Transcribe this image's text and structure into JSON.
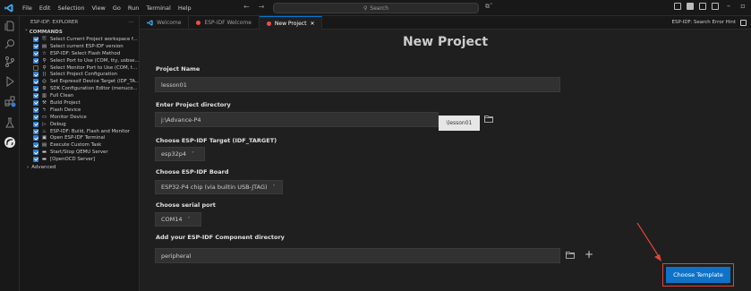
{
  "menu": [
    "File",
    "Edit",
    "Selection",
    "View",
    "Go",
    "Run",
    "Terminal",
    "Help"
  ],
  "search": {
    "placeholder": "Search"
  },
  "sidebar": {
    "title": "ESP-IDF: EXPLORER",
    "more": "···",
    "section": "COMMANDS",
    "items": [
      {
        "label": "Select Current Project workspace f...",
        "icon": "folders-icon",
        "glyph": "⎘",
        "checked": true
      },
      {
        "label": "Select current ESP-IDF version",
        "icon": "stack-icon",
        "glyph": "▤",
        "checked": true
      },
      {
        "label": "ESP-IDF: Select Flash Method",
        "icon": "star-icon",
        "glyph": "☆",
        "checked": true
      },
      {
        "label": "Select Port to Use (COM, tty, usbse...",
        "icon": "plug-icon",
        "glyph": "⚲",
        "checked": true
      },
      {
        "label": "Select Monitor Port to Use (COM, t...",
        "icon": "plug-icon",
        "glyph": "⚲",
        "checked": false
      },
      {
        "label": "Select Project Configuration",
        "icon": "brackets-icon",
        "glyph": "⟨⟩",
        "checked": true
      },
      {
        "label": "Set Espressif Device Target (IDF_TA...",
        "icon": "chip-icon",
        "glyph": "◎",
        "checked": true
      },
      {
        "label": "SDK Configuration Editor (menuco...",
        "icon": "gear-icon",
        "glyph": "⚙",
        "checked": true
      },
      {
        "label": "Full Clean",
        "icon": "trash-icon",
        "glyph": "▥",
        "checked": true
      },
      {
        "label": "Build Project",
        "icon": "wrench-icon",
        "glyph": "⚒",
        "checked": true
      },
      {
        "label": "Flash Device",
        "icon": "bolt-icon",
        "glyph": "ϟ",
        "checked": true
      },
      {
        "label": "Monitor Device",
        "icon": "monitor-icon",
        "glyph": "▭",
        "checked": true
      },
      {
        "label": "Debug",
        "icon": "debug-icon",
        "glyph": "▷",
        "checked": true
      },
      {
        "label": "ESP-IDF: Build, Flash and Monitor",
        "icon": "flame-icon",
        "glyph": "♨",
        "checked": true
      },
      {
        "label": "Open ESP-IDF Terminal",
        "icon": "terminal-icon",
        "glyph": "▣",
        "checked": true
      },
      {
        "label": "Execute Custom Task",
        "icon": "task-icon",
        "glyph": "▤",
        "checked": true
      },
      {
        "label": "Start/Stop QEMU Server",
        "icon": "server-icon",
        "glyph": "▬",
        "checked": true
      },
      {
        "label": "[OpenOCD Server]",
        "icon": "server-icon",
        "glyph": "▬",
        "checked": true
      }
    ],
    "advanced": "Advanced"
  },
  "tabs": [
    {
      "label": "Welcome",
      "icon": "vscode-icon",
      "active": false
    },
    {
      "label": "ESP-IDF Welcome",
      "icon": "esp-dot-icon",
      "active": false
    },
    {
      "label": "New Project",
      "icon": "esp-dot-icon",
      "active": true,
      "close": "✕"
    }
  ],
  "tab_right_label": "ESP-IDF: Search Error Hint",
  "page": {
    "title": "New Project",
    "project_name": {
      "label": "Project Name",
      "value": "lesson01"
    },
    "project_dir": {
      "label": "Enter Project directory",
      "value": "j:\\Advance-P4",
      "suffix": "\\lesson01"
    },
    "target": {
      "label": "Choose ESP-IDF Target (IDF_TARGET)",
      "value": "esp32p4"
    },
    "board": {
      "label": "Choose ESP-IDF Board",
      "value": "ESP32-P4 chip (via builtin USB-JTAG)"
    },
    "port": {
      "label": "Choose serial port",
      "value": "COM14"
    },
    "component": {
      "label": "Add your ESP-IDF Component directory",
      "value": "peripheral",
      "add": "+"
    },
    "choose_template": "Choose Template"
  },
  "colors": {
    "accent": "#0e72c9",
    "annotation": "#e0443a",
    "tab_dot": "#f14c4c"
  }
}
